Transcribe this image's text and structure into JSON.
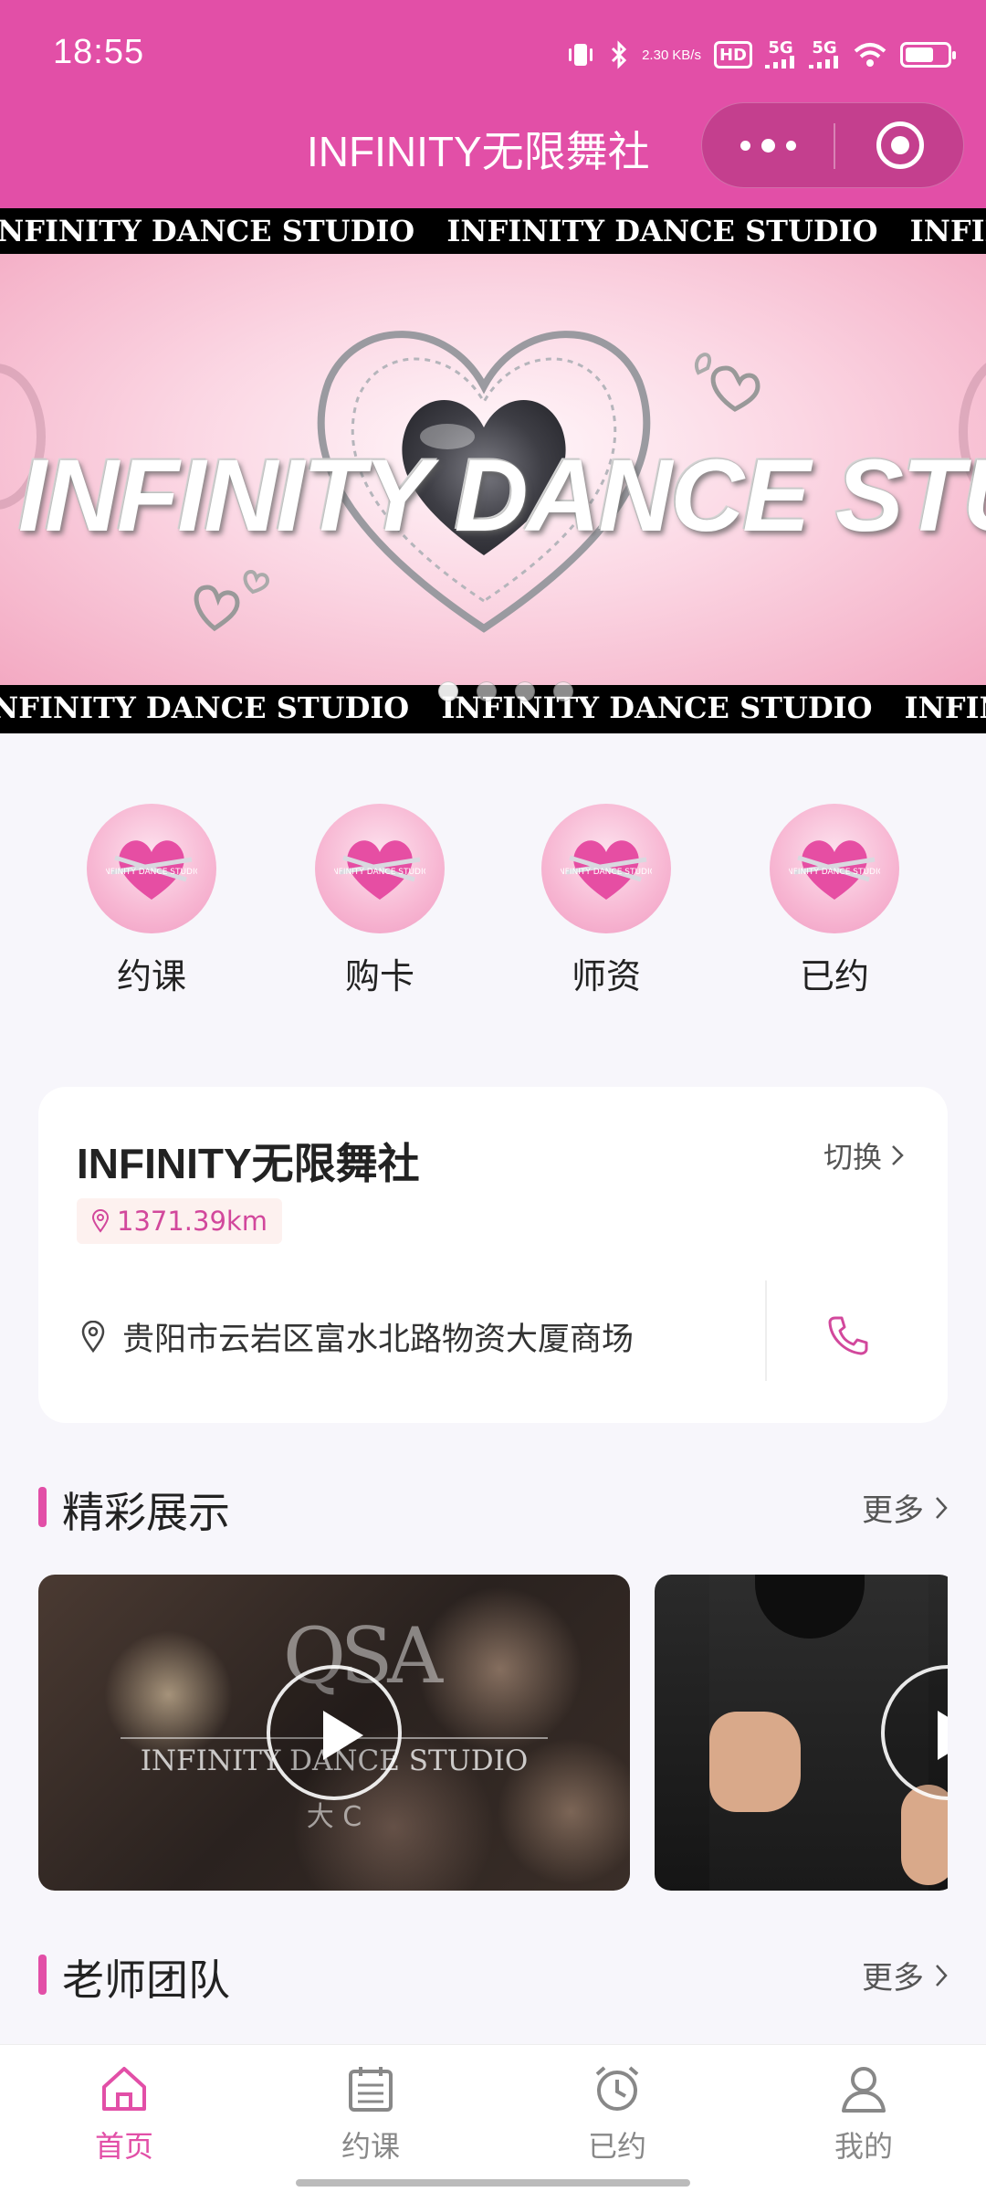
{
  "status_bar": {
    "time": "18:55",
    "net_speed_top": "2.30",
    "net_speed_bottom": "KB/s",
    "hd_label": "HD",
    "signal_1": "5G",
    "signal_2": "5G"
  },
  "nav": {
    "title": "INFINITY无限舞社"
  },
  "banner": {
    "ticker_text": "INFINITY DANCE STUDIO",
    "title": "INFINITY DANCE STUDIO",
    "slide_count": 4,
    "active_slide": 1
  },
  "quick_entries": [
    {
      "label": "约课"
    },
    {
      "label": "购卡"
    },
    {
      "label": "师资"
    },
    {
      "label": "已约"
    }
  ],
  "studio": {
    "name": "INFINITY无限舞社",
    "switch_label": "切换",
    "distance": "1371.39km",
    "address": "贵阳市云岩区富水北路物资大厦商场"
  },
  "sections": {
    "showcase": {
      "title": "精彩展示",
      "more": "更多"
    },
    "teachers": {
      "title": "老师团队",
      "more": "更多"
    }
  },
  "videos": [
    {
      "logo": "QSA",
      "studio": "INFINITY DANCE STUDIO",
      "subtitle": "大 C"
    }
  ],
  "tabbar": [
    {
      "label": "首页",
      "icon": "home-icon",
      "active": true
    },
    {
      "label": "约课",
      "icon": "calendar-icon",
      "active": false
    },
    {
      "label": "已约",
      "icon": "alarm-clock-icon",
      "active": false
    },
    {
      "label": "我的",
      "icon": "user-icon",
      "active": false
    }
  ],
  "colors": {
    "brand_pink": "#e24fa7",
    "page_bg": "#f7f6fb"
  }
}
